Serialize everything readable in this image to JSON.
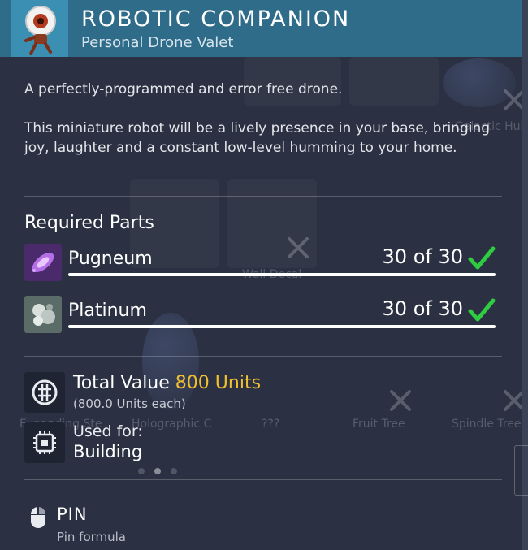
{
  "header": {
    "title": "ROBOTIC COMPANION",
    "subtitle": "Personal Drone Valet",
    "thumb_icon": "robot-drone-icon"
  },
  "description": {
    "lines": [
      "A perfectly-programmed and error free drone.",
      "This miniature robot will be a lively presence in your base, bringing joy, laughter and a constant low-level humming to your home."
    ]
  },
  "required_parts": {
    "title": "Required Parts",
    "items": [
      {
        "name": "Pugneum",
        "count": "30 of 30",
        "have": 30,
        "need": 30,
        "icon": "pugneum-icon",
        "complete": true
      },
      {
        "name": "Platinum",
        "count": "30 of 30",
        "have": 30,
        "need": 30,
        "icon": "platinum-icon",
        "complete": true
      }
    ]
  },
  "total_value": {
    "label": "Total Value",
    "value": "800 Units",
    "each": "(800.0 Units each)",
    "icon": "units-icon"
  },
  "used_for": {
    "label": "Used for:",
    "value": "Building",
    "icon": "chip-icon"
  },
  "pin": {
    "label": "PIN",
    "sub": "Pin formula",
    "icon": "mouse-icon"
  },
  "background_labels": [
    "Galactic Hub",
    "Expanding Ste",
    "Holographic C",
    "???",
    "Fruit Tree",
    "Spindle Tree",
    "Wall Decal"
  ],
  "colors": {
    "accent_header": "#2e6c8a",
    "value_yellow": "#f0c030",
    "check_green": "#2ecc40",
    "panel_bg": "#2b3142"
  }
}
